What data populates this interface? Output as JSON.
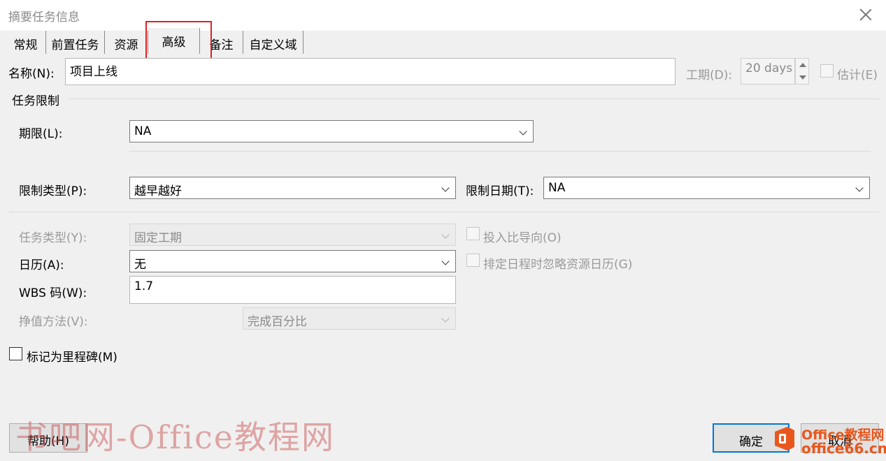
{
  "window": {
    "title": "摘要任务信息"
  },
  "tabs": [
    {
      "label": "常规"
    },
    {
      "label": "前置任务"
    },
    {
      "label": "资源"
    },
    {
      "label": "高级"
    },
    {
      "label": "备注"
    },
    {
      "label": "自定义域"
    }
  ],
  "active_tab": "高级",
  "name": {
    "label": "名称(N):",
    "value": "项目上线"
  },
  "duration": {
    "label": "工期(D):",
    "value": "20 days"
  },
  "estimated": {
    "label": "估计(E)",
    "checked": false
  },
  "constraints_section": {
    "title": "任务限制"
  },
  "deadline": {
    "label": "期限(L):",
    "value": "NA"
  },
  "constraint_type": {
    "label": "限制类型(P):",
    "value": "越早越好"
  },
  "constraint_date": {
    "label": "限制日期(T):",
    "value": "NA"
  },
  "task_type": {
    "label": "任务类型(Y):",
    "value": "固定工期"
  },
  "effort_driven": {
    "label": "投入比导向(O)",
    "checked": false
  },
  "calendar": {
    "label": "日历(A):",
    "value": "无"
  },
  "ignore_resource_calendars": {
    "label": "排定日程时忽略资源日历(G)",
    "checked": false
  },
  "wbs": {
    "label": "WBS 码(W):",
    "value": "1.7"
  },
  "earned_value": {
    "label": "挣值方法(V):",
    "value": "完成百分比"
  },
  "milestone": {
    "label": "标记为里程碑(M)",
    "checked": false
  },
  "buttons": {
    "help": "帮助(H)",
    "ok": "确定",
    "cancel": "取消"
  },
  "watermark": {
    "text": "书吧网-Office教程网"
  },
  "logo": {
    "top": "Office教程网",
    "bottom": "office66.cn"
  },
  "colors": {
    "highlight": "#e02020",
    "default_button_border": "#0078d7",
    "logo": "#e8571d"
  }
}
